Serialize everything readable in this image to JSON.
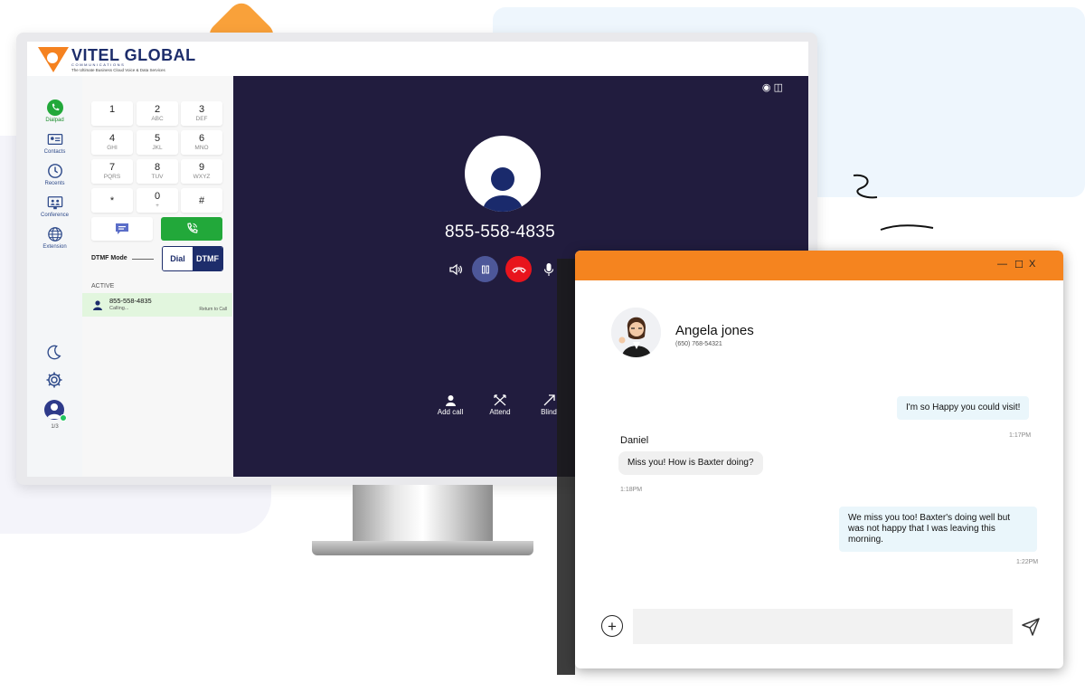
{
  "brand": {
    "name": "VITEL GLOBAL",
    "subtitle": "COMMUNICATIONS",
    "tagline": "The Ultimate Business Cloud Voice & Data Services"
  },
  "rail": {
    "items": [
      {
        "label": "Dialpad",
        "icon": "phone-icon"
      },
      {
        "label": "Contacts",
        "icon": "contact-card-icon"
      },
      {
        "label": "Recents",
        "icon": "clock-icon"
      },
      {
        "label": "Conference",
        "icon": "conference-icon"
      },
      {
        "label": "Extension",
        "icon": "globe-icon"
      }
    ],
    "bottom": {
      "theme_icon": "moon-icon",
      "settings_icon": "gear-icon",
      "user_count": "1/3"
    }
  },
  "dialpad": {
    "keys": [
      {
        "digit": "1",
        "letters": ""
      },
      {
        "digit": "2",
        "letters": "ABC"
      },
      {
        "digit": "3",
        "letters": "DEF"
      },
      {
        "digit": "4",
        "letters": "GHI"
      },
      {
        "digit": "5",
        "letters": "JKL"
      },
      {
        "digit": "6",
        "letters": "MNO"
      },
      {
        "digit": "7",
        "letters": "PQRS"
      },
      {
        "digit": "8",
        "letters": "TUV"
      },
      {
        "digit": "9",
        "letters": "WXYZ"
      },
      {
        "digit": "*",
        "letters": ""
      },
      {
        "digit": "0",
        "letters": "+"
      },
      {
        "digit": "#",
        "letters": ""
      }
    ],
    "dtmf_mode_label": "DTMF Mode",
    "mode_dial": "Dial",
    "mode_dtmf": "DTMF",
    "active_label": "ACTIVE",
    "active_call": {
      "number": "855-558-4835",
      "status": "Calling...",
      "return_label": "Return to Call"
    }
  },
  "call": {
    "number": "855-558-4835",
    "actions": [
      {
        "label": "Add call",
        "icon": "add-user-icon"
      },
      {
        "label": "Attend",
        "icon": "transfer-icon"
      },
      {
        "label": "Blind",
        "icon": "arrow-icon"
      }
    ]
  },
  "chat": {
    "window_controls": {
      "minimize": "—",
      "maximize": "☐",
      "close": "X"
    },
    "contact": {
      "name": "Angela jones",
      "phone": "(650) 768-54321"
    },
    "messages": [
      {
        "direction": "out",
        "text": "I'm so Happy you could visit!",
        "time": "1:17PM"
      },
      {
        "direction": "in",
        "sender": "Daniel",
        "text": "Miss you! How is Baxter doing?",
        "time": "1:18PM"
      },
      {
        "direction": "out",
        "text": "We miss you too! Baxter's doing well but was not happy that I was leaving this morning.",
        "time": "1:22PM"
      }
    ],
    "input": {
      "value": "",
      "placeholder": ""
    }
  },
  "colors": {
    "accent_orange": "#f5841f",
    "call_bg": "#211c3e",
    "green": "#22a83a",
    "red": "#e8141d",
    "navy": "#1d2d6b"
  }
}
